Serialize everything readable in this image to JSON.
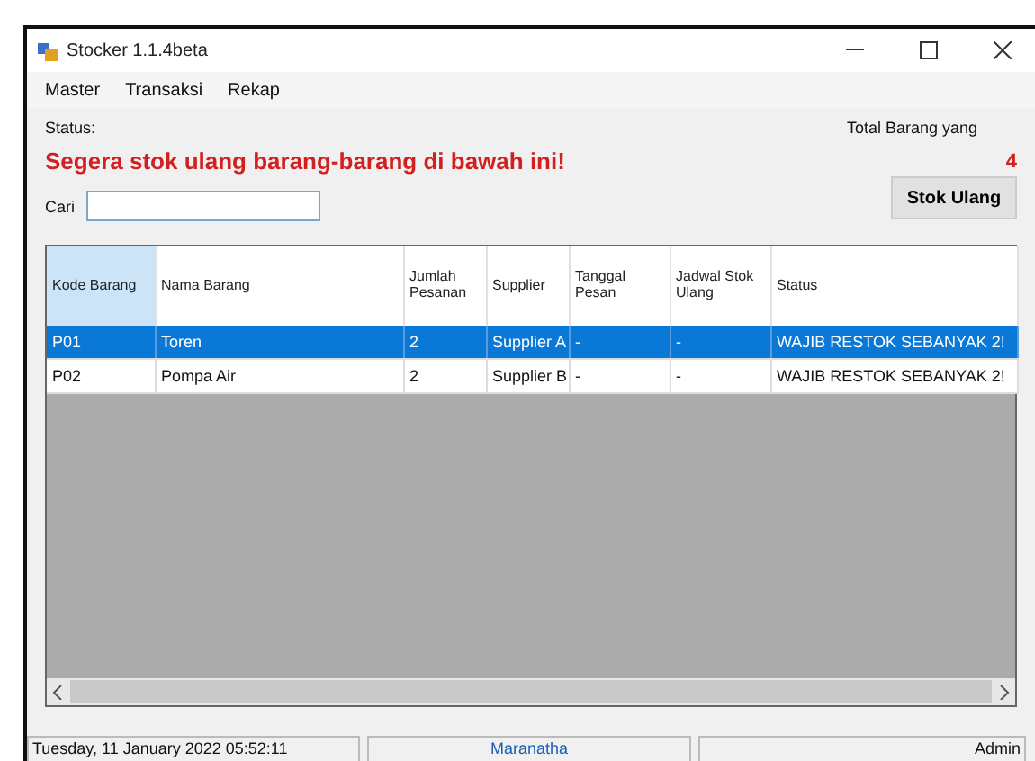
{
  "window": {
    "title": "Stocker 1.1.4beta"
  },
  "menu": [
    "Master",
    "Transaksi",
    "Rekap"
  ],
  "status_label": "Status:",
  "status_message": "Segera stok ulang barang-barang di bawah ini!",
  "total_label": "Total Barang yang",
  "total_value": "4",
  "search": {
    "label": "Cari"
  },
  "restock_button": "Stok Ulang",
  "table": {
    "columns": [
      "Kode Barang",
      "Nama Barang",
      "Jumlah Pesanan",
      "Supplier",
      "Tanggal Pesan",
      "Jadwal Stok Ulang",
      "Status"
    ],
    "rows": [
      {
        "selected": true,
        "cells": [
          "P01",
          "Toren",
          "2",
          "Supplier A",
          "-",
          "-",
          "WAJIB RESTOK SEBANYAK 2!"
        ]
      },
      {
        "selected": false,
        "cells": [
          "P02",
          "Pompa Air",
          "2",
          "Supplier B",
          "-",
          "-",
          "WAJIB RESTOK SEBANYAK 2!"
        ]
      }
    ]
  },
  "status_bar": [
    "Tuesday, 11 January 2022 05:52:11",
    "Maranatha",
    "Admin"
  ]
}
